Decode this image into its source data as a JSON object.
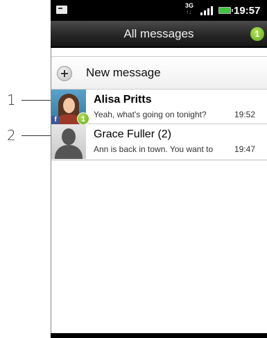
{
  "callouts": [
    "1",
    "2"
  ],
  "status_bar": {
    "network": "3G",
    "time": "19:57"
  },
  "title_bar": {
    "title": "All messages",
    "unread_badge": "1"
  },
  "new_message": {
    "label": "New message"
  },
  "conversations": [
    {
      "name": "Alisa Pritts",
      "preview": "Yeah, what's going on tonight?",
      "time": "19:52",
      "unread_badge": "1",
      "source_icon": "f"
    },
    {
      "name": "Grace Fuller (2)",
      "preview": "Ann is back in town. You want to",
      "time": "19:47"
    }
  ],
  "colors": {
    "title_bar": "#2a2a2a",
    "badge_green": "#5aa817",
    "facebook_blue": "#3b5998"
  }
}
